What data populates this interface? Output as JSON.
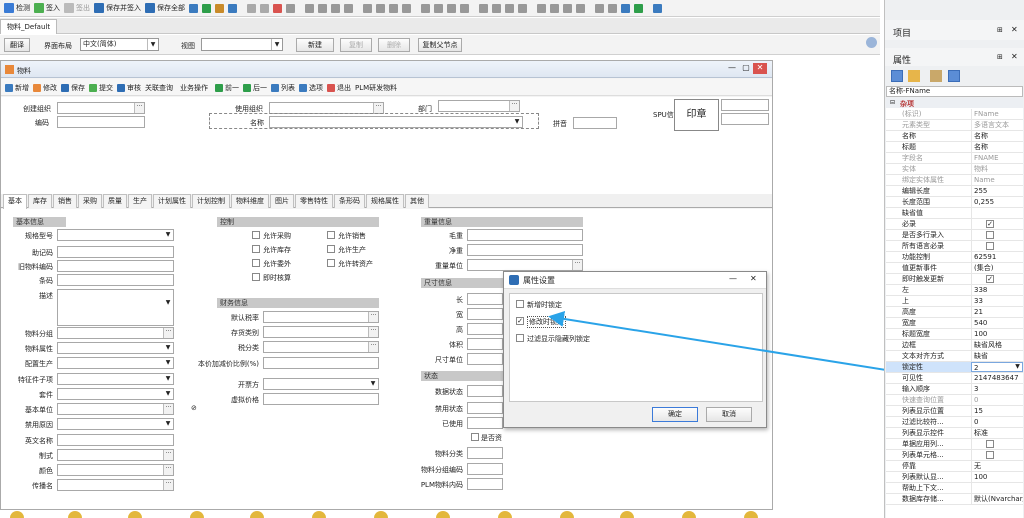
{
  "toolbar": {
    "items": [
      {
        "label": "检测",
        "icon": "check-icon",
        "color": "#3a7bd5",
        "enabled": true
      },
      {
        "label": "签入",
        "icon": "checkin-icon",
        "color": "#4caf50",
        "enabled": true
      },
      {
        "label": "签出",
        "icon": "checkout-icon",
        "color": "#aaaaaa",
        "enabled": false
      },
      {
        "label": "保存并签入",
        "icon": "save-checkin-icon",
        "color": "#2e6db4",
        "enabled": true
      },
      {
        "label": "保存全部",
        "icon": "save-all-icon",
        "color": "#2e6db4",
        "enabled": true
      }
    ]
  },
  "doc_tab": {
    "label": "物料_Default"
  },
  "toolbar2": {
    "translate": "翻译",
    "layout_label": "界面布局",
    "layout_value": "中文(简体)",
    "view_label": "视图",
    "view_value": "",
    "new_label": "新建",
    "copy_label": "复制",
    "delete_label": "删除",
    "copy_child_label": "复制父节点"
  },
  "window": {
    "title": "物料",
    "toolbar": [
      "新增",
      "修改",
      "保存",
      "提交",
      "审核",
      "关联查询",
      "业务操作",
      "前一",
      "后一",
      "列表",
      "选项",
      "退出",
      "PLM研发物料"
    ]
  },
  "header_form": {
    "create_org": "创建组织",
    "code": "编码",
    "use_org": "使用组织",
    "name": "名称",
    "dept": "部门",
    "pinyin": "拼音",
    "spu": "SPU信息",
    "stamp": "印章"
  },
  "tabs": [
    "基本",
    "库存",
    "销售",
    "采购",
    "质量",
    "生产",
    "计划属性",
    "计划控制",
    "物料维度",
    "图片",
    "零售特性",
    "条形码",
    "规格属性",
    "其他"
  ],
  "basic_section": {
    "title": "基本信息",
    "fields": [
      "规格型号",
      "助记码",
      "旧物料编码",
      "条码",
      "描述",
      "物料分组",
      "物料属性",
      "配置生产",
      "特征件子项",
      "套件",
      "基本单位",
      "禁用原因",
      "英文名称",
      "制式",
      "颜色",
      "传播名"
    ]
  },
  "control_section": {
    "title": "控制",
    "checks_left": [
      "允许采购",
      "允许库存",
      "允许委外",
      "即时核算"
    ],
    "checks_right": [
      "允许销售",
      "允许生产",
      "允许转资产"
    ]
  },
  "finance_section": {
    "title": "财务信息",
    "fields": [
      "默认税率",
      "存货类别",
      "税分类",
      "本价加减价比例(%)",
      "开票方",
      "虚拟价格"
    ]
  },
  "weight_section": {
    "title": "重量信息",
    "fields": [
      "毛重",
      "净重",
      "重量单位"
    ]
  },
  "size_section": {
    "title": "尺寸信息",
    "fields": [
      "长",
      "宽",
      "高",
      "体积",
      "尺寸单位"
    ]
  },
  "status_section": {
    "title": "状态",
    "fields": [
      "数据状态",
      "禁用状态",
      "已使用"
    ],
    "check": "是否资",
    "more_fields": [
      "物料分类",
      "物料分组编码",
      "PLM物料内码"
    ]
  },
  "dialog": {
    "title": "属性设置",
    "options": [
      {
        "label": "新增时锁定",
        "checked": false
      },
      {
        "label": "修改时锁定",
        "checked": true
      },
      {
        "label": "过滤显示隐藏列锁定",
        "checked": false
      }
    ],
    "ok": "确定",
    "cancel": "取消"
  },
  "right_panel": {
    "project_title": "项目",
    "props_title": "属性",
    "field_name": "名称-FName",
    "category": "杂项",
    "rows": [
      {
        "n": "(标识)",
        "v": "FName",
        "gray": true
      },
      {
        "n": "元素类型",
        "v": "多语言文本",
        "gray": true
      },
      {
        "n": "名称",
        "v": "名称"
      },
      {
        "n": "标题",
        "v": "名称"
      },
      {
        "n": "字段名",
        "v": "FNAME",
        "gray": true
      },
      {
        "n": "实体",
        "v": "物料",
        "gray": true
      },
      {
        "n": "绑定实体属性",
        "v": "Name",
        "gray": true
      },
      {
        "n": "编辑长度",
        "v": "255"
      },
      {
        "n": "长度范围",
        "v": "0,255"
      },
      {
        "n": "缺省值",
        "v": ""
      },
      {
        "n": "必录",
        "v": "",
        "check": true,
        "checked": true
      },
      {
        "n": "是否多行录入",
        "v": "",
        "check": true
      },
      {
        "n": "所有语言必录",
        "v": "",
        "check": true
      },
      {
        "n": "功能控制",
        "v": "62591"
      },
      {
        "n": "值更新事件",
        "v": "(集合)"
      },
      {
        "n": "即时触发更新",
        "v": "",
        "check": true,
        "checked": true
      },
      {
        "n": "左",
        "v": "338"
      },
      {
        "n": "上",
        "v": "33"
      },
      {
        "n": "高度",
        "v": "21"
      },
      {
        "n": "宽度",
        "v": "540"
      },
      {
        "n": "标题宽度",
        "v": "100"
      },
      {
        "n": "边框",
        "v": "缺省风格"
      },
      {
        "n": "文本对齐方式",
        "v": "缺省"
      },
      {
        "n": "锁定性",
        "v": "2",
        "selected": true
      },
      {
        "n": "可见性",
        "v": "2147483647"
      },
      {
        "n": "输入顺序",
        "v": "3"
      },
      {
        "n": "快速查询位置",
        "v": "0",
        "gray": true
      },
      {
        "n": "列表显示位置",
        "v": "15"
      },
      {
        "n": "过滤比较符...",
        "v": "0"
      },
      {
        "n": "列表显示控件",
        "v": "标准"
      },
      {
        "n": "单据应用列...",
        "v": "",
        "check": true
      },
      {
        "n": "列表单元格...",
        "v": "",
        "check": true
      },
      {
        "n": "停靠",
        "v": "无"
      },
      {
        "n": "列表默认显...",
        "v": "100"
      },
      {
        "n": "帮助上下文...",
        "v": ""
      },
      {
        "n": "数据库存储...",
        "v": "默认(Nvarchar/N..."
      }
    ]
  }
}
